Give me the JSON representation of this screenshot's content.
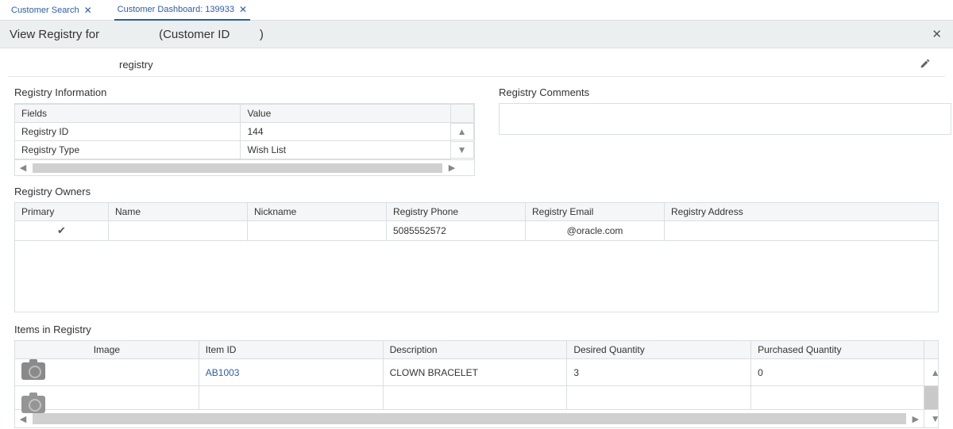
{
  "tabs": [
    {
      "label": "Customer Search"
    },
    {
      "label": "Customer Dashboard: 139933"
    }
  ],
  "header": {
    "prefix": "View Registry for",
    "paren_prefix": "(Customer ID",
    "paren_suffix": ")"
  },
  "subheader": {
    "title": "registry"
  },
  "registry_info": {
    "title": "Registry Information",
    "headers": {
      "fields": "Fields",
      "value": "Value"
    },
    "rows": [
      {
        "field": "Registry ID",
        "value": "144"
      },
      {
        "field": "Registry Type",
        "value": "Wish List"
      }
    ]
  },
  "registry_comments": {
    "title": "Registry Comments"
  },
  "owners": {
    "title": "Registry Owners",
    "headers": {
      "primary": "Primary",
      "name": "Name",
      "nickname": "Nickname",
      "phone": "Registry Phone",
      "email": "Registry Email",
      "address": "Registry Address"
    },
    "rows": [
      {
        "primary": true,
        "name": "",
        "nickname": "",
        "phone": "5085552572",
        "email": "@oracle.com",
        "address": ""
      }
    ]
  },
  "items": {
    "title": "Items in Registry",
    "headers": {
      "image": "Image",
      "item_id": "Item ID",
      "description": "Description",
      "desired_qty": "Desired Quantity",
      "purchased_qty": "Purchased Quantity"
    },
    "rows": [
      {
        "item_id": "AB1003",
        "description": "CLOWN BRACELET",
        "desired_qty": "3",
        "purchased_qty": "0"
      },
      {
        "item_id": "",
        "description": "",
        "desired_qty": "",
        "purchased_qty": ""
      }
    ]
  }
}
